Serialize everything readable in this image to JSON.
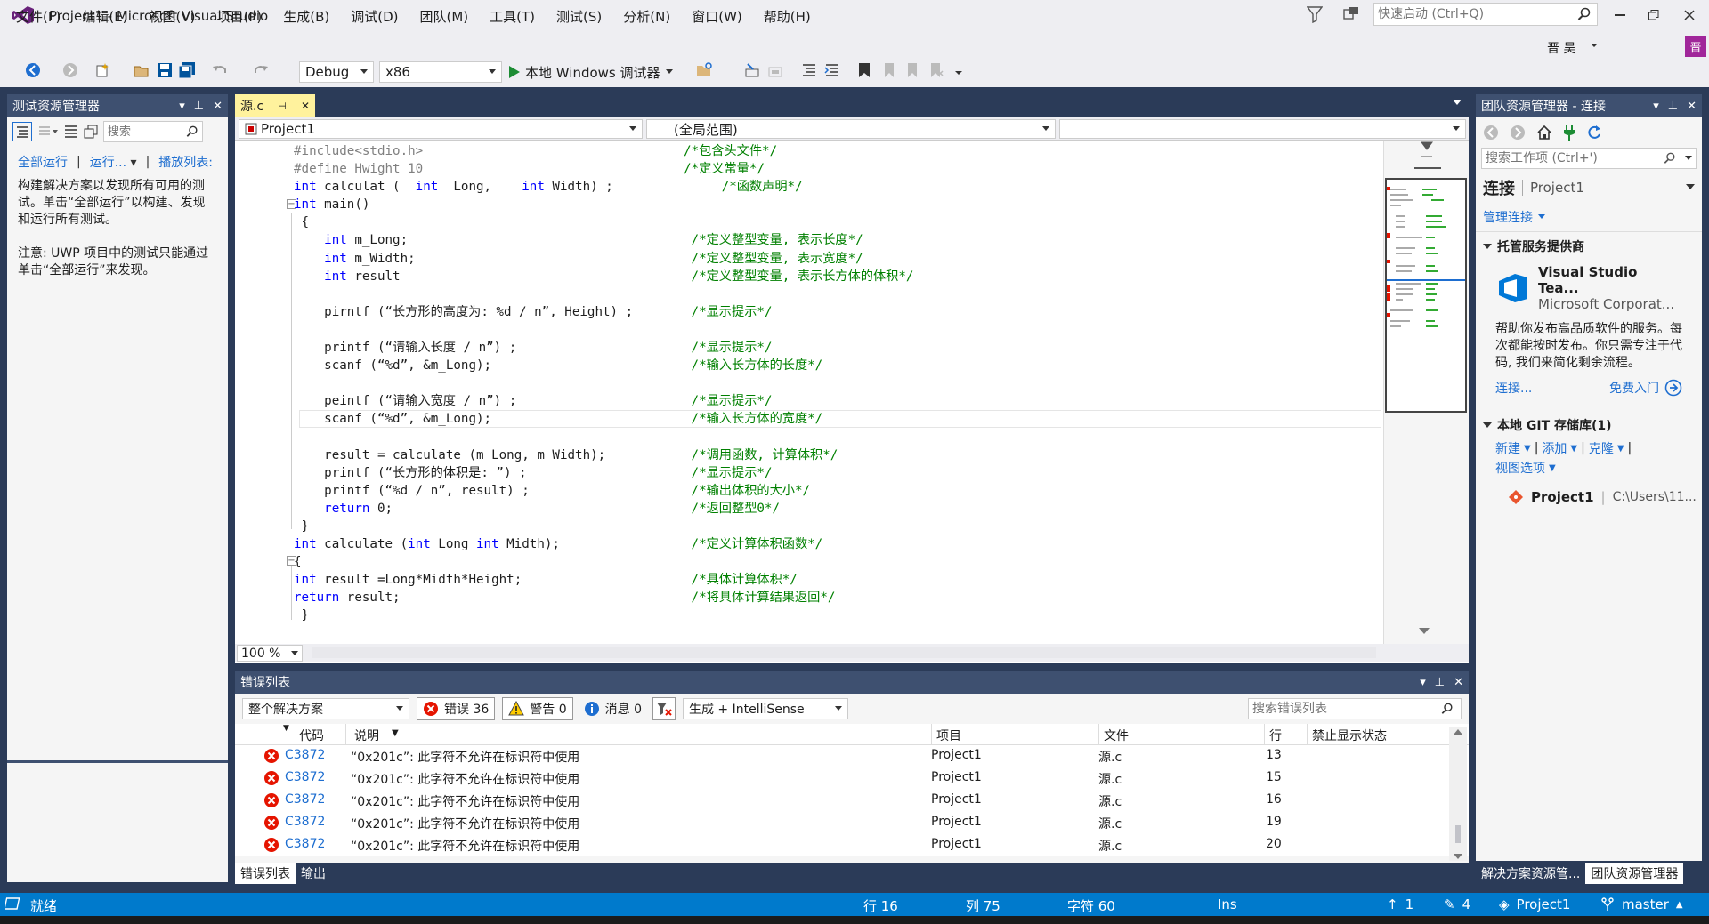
{
  "window": {
    "title": "Project1 - Microsoft Visual Studio",
    "quick_launch_placeholder": "快速启动 (Ctrl+Q)",
    "user_name": "晋 吴",
    "avatar_letter": "晋"
  },
  "menu": [
    "文件(F)",
    "编辑(E)",
    "视图(V)",
    "项目(P)",
    "生成(B)",
    "调试(D)",
    "团队(M)",
    "工具(T)",
    "测试(S)",
    "分析(N)",
    "窗口(W)",
    "帮助(H)"
  ],
  "toolbar": {
    "configuration": "Debug",
    "platform": "x86",
    "run_label": "本地 Windows 调试器"
  },
  "test_explorer": {
    "title": "测试资源管理器",
    "search_placeholder": "搜索",
    "run_all": "全部运行",
    "run": "运行...",
    "playlist": "播放列表:",
    "message1": "构建解决方案以发现所有可用的测试。单击“全部运行”以构建、发现和运行所有测试。",
    "message2": "注意: UWP 项目中的测试只能通过单击“全部运行”来发现。"
  },
  "editor": {
    "tab_label": "源.c",
    "nav_project": "Project1",
    "nav_scope": "(全局范围)",
    "nav_member": "",
    "zoom": "100 %",
    "lines": [
      {
        "indent": "",
        "code": "#include<stdio.h>",
        "comment": "/*包含头文件*/"
      },
      {
        "indent": "",
        "code": "#define Hwight 10",
        "comment": "/*定义常量*/"
      },
      {
        "indent": "",
        "code": "int calculat (  int  Long,    int Width) ;",
        "comment": "     /*函数声明*/"
      },
      {
        "indent": "",
        "code": "int main()",
        "comment": ""
      },
      {
        "indent": "",
        "code": " {",
        "comment": ""
      },
      {
        "indent": "",
        "code": "    int m_Long;",
        "comment": " /*定义整型变量, 表示长度*/"
      },
      {
        "indent": "",
        "code": "    int m_Width;",
        "comment": " /*定义整型变量, 表示宽度*/"
      },
      {
        "indent": "",
        "code": "    int result",
        "comment": " /*定义整型变量, 表示长方体的体积*/"
      },
      {
        "indent": "",
        "code": "",
        "comment": ""
      },
      {
        "indent": "",
        "code": "    pirntf (“长方形的高度为: %d / n”, Height) ;",
        "comment": " /*显示提示*/"
      },
      {
        "indent": "",
        "code": "",
        "comment": ""
      },
      {
        "indent": "",
        "code": "    printf (“请输入长度 / n”) ;",
        "comment": " /*显示提示*/"
      },
      {
        "indent": "",
        "code": "    scanf (“%d”, &m_Long);",
        "comment": " /*输入长方体的长度*/"
      },
      {
        "indent": "",
        "code": "",
        "comment": ""
      },
      {
        "indent": "",
        "code": "    peintf (“请输入宽度 / n”) ;",
        "comment": " /*显示提示*/"
      },
      {
        "indent": "",
        "code": "    scanf (“%d”, &m_Long);",
        "comment": " /*输入长方体的宽度*/"
      },
      {
        "indent": "",
        "code": "",
        "comment": ""
      },
      {
        "indent": "",
        "code": "    result = calculate (m_Long, m_Width);",
        "comment": " /*调用函数, 计算体积*/"
      },
      {
        "indent": "",
        "code": "    printf (“长方形的体积是: ”) ;",
        "comment": " /*显示提示*/"
      },
      {
        "indent": "",
        "code": "    printf (“%d / n”, result) ;",
        "comment": " /*输出体积的大小*/"
      },
      {
        "indent": "",
        "code": "    return 0;",
        "comment": " /*返回整型0*/"
      },
      {
        "indent": "",
        "code": " }",
        "comment": ""
      },
      {
        "indent": "",
        "code": "int calculate (int Long int Midth);",
        "comment": " /*定义计算体积函数*/"
      },
      {
        "indent": "",
        "code": "{",
        "comment": ""
      },
      {
        "indent": "",
        "code": "int result =Long*Midth*Height;",
        "comment": " /*具体计算体积*/"
      },
      {
        "indent": "",
        "code": "return result;",
        "comment": " /*将具体计算结果返回*/"
      },
      {
        "indent": "",
        "code": " }",
        "comment": ""
      }
    ]
  },
  "error_list": {
    "title": "错误列表",
    "scope": "整个解决方案",
    "errors_label": "错误 36",
    "warnings_label": "警告 0",
    "messages_label": "消息 0",
    "build_filter": "生成 + IntelliSense",
    "search_placeholder": "搜索错误列表",
    "columns": [
      "代码",
      "说明",
      "项目",
      "文件",
      "行",
      "禁止显示状态"
    ],
    "rows": [
      {
        "code": "C3872",
        "desc": "“0x201c”: 此字符不允许在标识符中使用",
        "project": "Project1",
        "file": "源.c",
        "line": "13"
      },
      {
        "code": "C3872",
        "desc": "“0x201c”: 此字符不允许在标识符中使用",
        "project": "Project1",
        "file": "源.c",
        "line": "15"
      },
      {
        "code": "C3872",
        "desc": "“0x201c”: 此字符不允许在标识符中使用",
        "project": "Project1",
        "file": "源.c",
        "line": "16"
      },
      {
        "code": "C3872",
        "desc": "“0x201c”: 此字符不允许在标识符中使用",
        "project": "Project1",
        "file": "源.c",
        "line": "19"
      },
      {
        "code": "C3872",
        "desc": "“0x201c”: 此字符不允许在标识符中使用",
        "project": "Project1",
        "file": "源.c",
        "line": "20"
      }
    ],
    "tabs": [
      "错误列表",
      "输出"
    ]
  },
  "team_explorer": {
    "title": "团队资源管理器 - 连接",
    "search_placeholder": "搜索工作项 (Ctrl+')",
    "connect": "连接",
    "project": "Project1",
    "manage": "管理连接",
    "hosted_title": "托管服务提供商",
    "vsts_name": "Visual Studio Tea...",
    "vsts_corp": "Microsoft Corporat...",
    "description": "帮助你发布高品质软件的服务。每次都能按时发布。你只需专注于代码, 我们来简化剩余流程。",
    "connect_link": "连接...",
    "free_start": "免费入门",
    "git_title": "本地 GIT 存储库(1)",
    "git_new": "新建",
    "git_add": "添加",
    "git_clone": "克隆",
    "git_view": "视图选项",
    "repo_name": "Project1",
    "repo_path": "C:\\Users\\11...",
    "tabs": [
      "解决方案资源管...",
      "团队资源管理器"
    ]
  },
  "status": {
    "ready": "就绪",
    "row": "行 16",
    "col": "列 75",
    "char": "字符 60",
    "ins": "Ins",
    "push": "1",
    "changes": "4",
    "project": "Project1",
    "branch": "master"
  },
  "colors": {
    "accent": "#007acc",
    "panel_header": "#3e5070",
    "error_red": "#e51400",
    "tab_yellow": "#fff29d"
  }
}
